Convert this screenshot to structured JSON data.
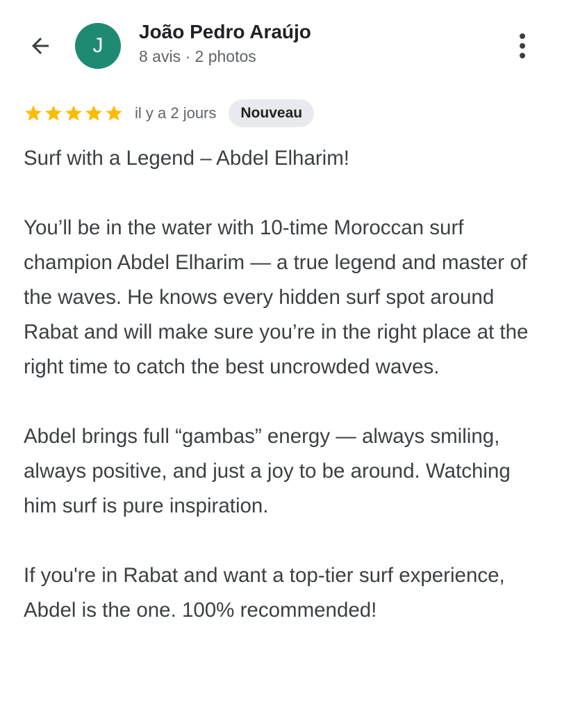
{
  "header": {
    "back_icon": "arrow-back-icon",
    "avatar_letter": "J",
    "avatar_color": "#1f8a72",
    "user_name": "João Pedro Araújo",
    "user_meta": "8 avis · 2 photos",
    "more_icon": "more-vertical-icon"
  },
  "review": {
    "rating": 5,
    "rating_max": 5,
    "star_color": "#fbbc04",
    "date": "il y a 2 jours",
    "badge": "Nouveau",
    "paragraphs": [
      "Surf with a Legend – Abdel Elharim!",
      "You’ll be in the water with 10-time Moroccan surf champion Abdel Elharim — a true legend and master of the waves. He knows every hidden surf spot around Rabat and will make sure you’re in the right place at the right time to catch the best uncrowded waves.",
      "Abdel brings full “gambas” energy — always smiling, always positive, and just a joy to be around. Watching him surf is pure inspiration.",
      "If you're in Rabat and want a top-tier surf experience, Abdel is the one. 100% recommended!"
    ]
  }
}
